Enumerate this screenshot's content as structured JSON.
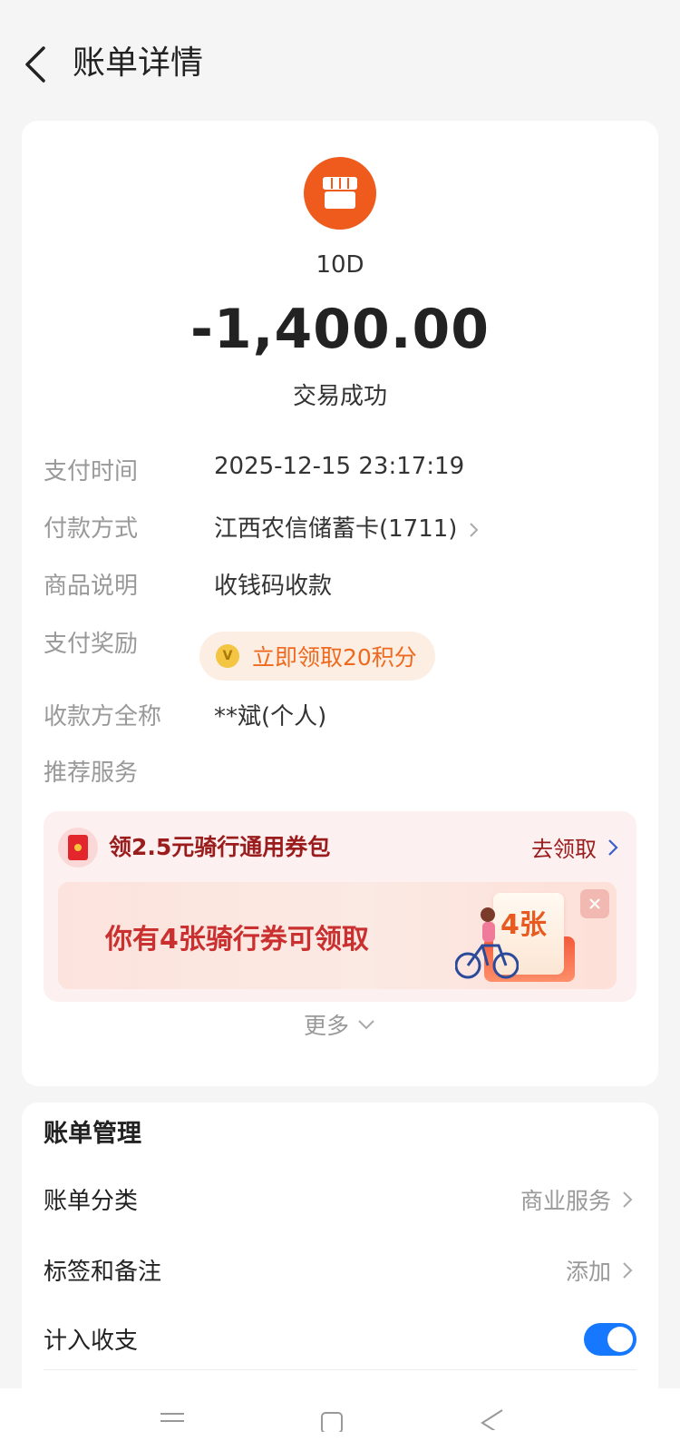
{
  "header": {
    "title": "账单详情"
  },
  "merchant": {
    "name": "10D",
    "icon": "store-icon",
    "icon_color": "#ef5a1d"
  },
  "amount": "-1,400.00",
  "status": "交易成功",
  "details": [
    {
      "label": "支付时间",
      "value": "2025-12-15 23:17:19"
    },
    {
      "label": "付款方式",
      "value": "江西农信储蓄卡(1711)"
    },
    {
      "label": "商品说明",
      "value": "收钱码收款"
    },
    {
      "label": "支付奖励",
      "value": "立即领取20积分"
    },
    {
      "label": "收款方全称",
      "value": "**斌(个人)"
    },
    {
      "label": "推荐服务"
    }
  ],
  "promo": {
    "title": "领2.5元骑行通用券包",
    "action": "去领取",
    "banner_text": "你有4张骑行券可领取",
    "card_count": "4张"
  },
  "more": "更多",
  "manage": {
    "title": "账单管理",
    "rows": [
      {
        "label": "账单分类",
        "value": "商业服务"
      },
      {
        "label": "标签和备注",
        "value": "添加"
      },
      {
        "label": "计入收支",
        "toggle_on": true
      }
    ]
  },
  "colors": {
    "accent": "#1677ff",
    "reward": "#ee6a1f",
    "promo_text": "#9b1c1c"
  }
}
